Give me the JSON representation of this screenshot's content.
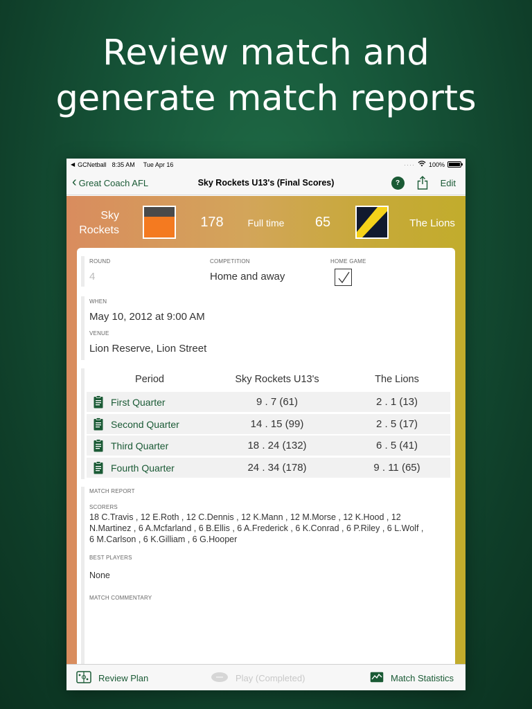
{
  "headline": {
    "line1": "Review match and",
    "line2": "generate match reports"
  },
  "statusbar": {
    "app": "GCNetball",
    "time": "8:35 AM",
    "date": "Tue Apr 16",
    "battery": "100%"
  },
  "navbar": {
    "back_label": "Great Coach AFL",
    "title": "Sky Rockets U13's (Final Scores)",
    "help_label": "?",
    "edit_label": "Edit"
  },
  "scoreboard": {
    "home_name_line1": "Sky",
    "home_name_line2": "Rockets",
    "home_score": "178",
    "status": "Full time",
    "away_score": "65",
    "away_name": "The Lions"
  },
  "details": {
    "round_label": "ROUND",
    "round_value": "4",
    "competition_label": "COMPETITION",
    "competition_value": "Home and away",
    "home_game_label": "HOME GAME",
    "when_label": "WHEN",
    "when_value": "May 10, 2012 at 9:00 AM",
    "venue_label": "VENUE",
    "venue_value": "Lion Reserve, Lion Street"
  },
  "scores_table": {
    "headers": [
      "Period",
      "Sky Rockets U13's",
      "The Lions"
    ],
    "rows": [
      {
        "period": "First Quarter",
        "home": "9 . 7 (61)",
        "away": "2 . 1 (13)"
      },
      {
        "period": "Second Quarter",
        "home": "14 . 15 (99)",
        "away": "2 . 5 (17)"
      },
      {
        "period": "Third Quarter",
        "home": "18 . 24 (132)",
        "away": "6 . 5 (41)"
      },
      {
        "period": "Fourth Quarter",
        "home": "24 . 34 (178)",
        "away": "9 . 11 (65)"
      }
    ]
  },
  "report": {
    "match_report_label": "MATCH REPORT",
    "scorers_label": "SCORERS",
    "scorers_line1": "18 C.Travis , 12 E.Roth , 12 C.Dennis , 12 K.Mann , 12 M.Morse , 12 K.Hood , 12",
    "scorers_line2": "N.Martinez , 6 A.Mcfarland , 6 B.Ellis , 6 A.Frederick , 6 K.Conrad , 6 P.Riley , 6 L.Wolf ,",
    "scorers_line3": "6 M.Carlson , 6 K.Gilliam , 6 G.Hooper",
    "best_players_label": "BEST PLAYERS",
    "best_players_value": "None",
    "commentary_label": "MATCH COMMENTARY"
  },
  "toolbar": {
    "review_label": "Review Plan",
    "play_label": "Play (Completed)",
    "stats_label": "Match Statistics"
  },
  "colors": {
    "accent": "#1a5a35",
    "home_guernsey_top": "#4a4a4a",
    "home_guernsey_body": "#f47a20",
    "away_guernsey_base": "#111a2e",
    "away_guernsey_stripe": "#f5d21a"
  }
}
